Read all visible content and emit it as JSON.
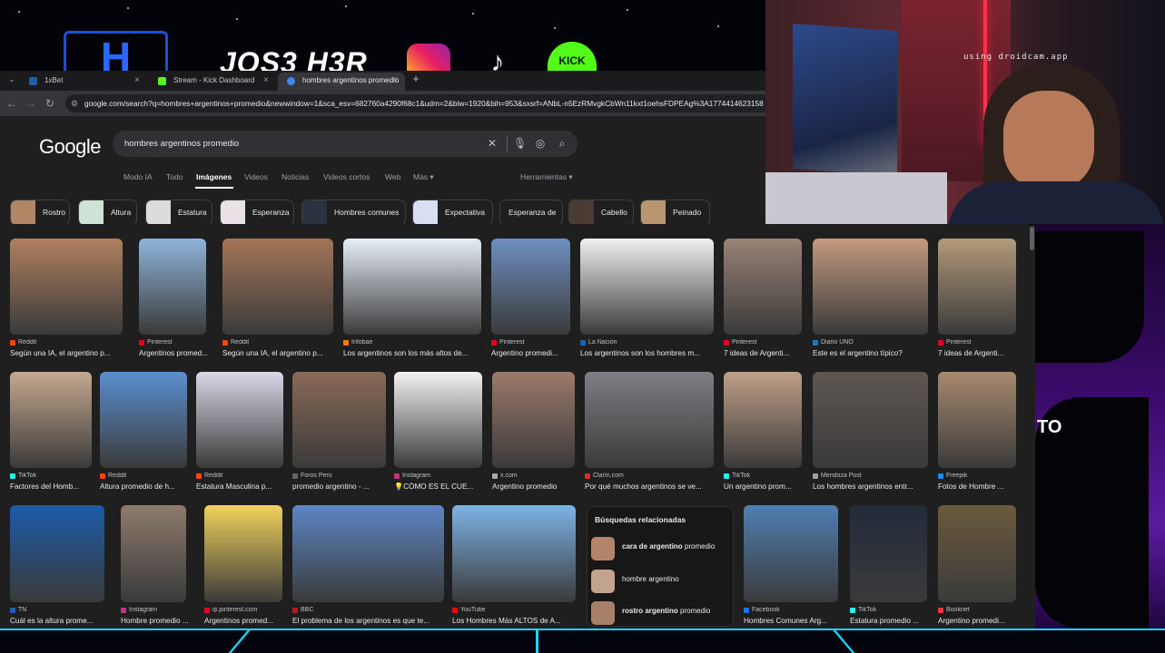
{
  "stream": {
    "logo_letter": "H",
    "streamer_name": "JOS3 H3R",
    "tiktok_glyph": "♪",
    "kick_label": "KICK",
    "webcam_watermark": "using droidcam.app",
    "overlay_text": "TO"
  },
  "browser": {
    "tabs": [
      {
        "label": "1xBet",
        "favicon_color": "#1e5fa8"
      },
      {
        "label": "Stream - Kick Dashboard",
        "favicon_color": "#53fc18"
      },
      {
        "label": "hombres argentinos promedio",
        "favicon_color": "#4285f4"
      }
    ],
    "url": "google.com/search?q=hombres+argentinos+promedio&newwindow=1&sca_esv=682760a4290f68c1&udm=2&biw=1920&bih=953&sxsrf=ANbL-n5EzRMvgkCbWn11kxt1oehsFDPEAg%3A1774414623158"
  },
  "search": {
    "logo": "Google",
    "query": "hombres argentinos promedio",
    "tabs": [
      "Modo IA",
      "Todo",
      "Imágenes",
      "Videos",
      "Noticias",
      "Videos cortos",
      "Web",
      "Más ▾"
    ],
    "active_tab": "Imágenes",
    "tools": "Herramientas ▾",
    "chips": [
      "Rostro",
      "Altura",
      "Estatura",
      "Esperanza",
      "Hombres comunes",
      "Expectativa",
      "Esperanza de",
      "Cabello",
      "Peinado"
    ]
  },
  "results": [
    {
      "source": "Reddit",
      "title": "Según una IA, el argentino p...",
      "color": "#b0805f",
      "icon": "#ff4500"
    },
    {
      "source": "Pinterest",
      "title": "Argentinos promed...",
      "color": "#8fb4d9",
      "icon": "#e60023"
    },
    {
      "source": "Reddit",
      "title": "Según una IA, el argentino p...",
      "color": "#a57658",
      "icon": "#ff4500"
    },
    {
      "source": "Infobae",
      "title": "Los argentinos son los más altos de...",
      "color": "#e7eef7",
      "icon": "#f57c00"
    },
    {
      "source": "Pinterest",
      "title": "Argentino promedi...",
      "color": "#6e8fc0",
      "icon": "#e60023"
    },
    {
      "source": "La Nación",
      "title": "Los argentinos son los hombres m...",
      "color": "#f1f1f1",
      "icon": "#1565c0"
    },
    {
      "source": "Pinterest",
      "title": "7 ideas de Argenti...",
      "color": "#9a8276",
      "icon": "#e60023"
    },
    {
      "source": "Diario UNO",
      "title": "Este es el argentino típico?",
      "color": "#c39a80",
      "icon": "#1976d2"
    },
    {
      "source": "Pinterest",
      "title": "7 ideas de Argenti...",
      "color": "#b39a7a",
      "icon": "#e60023"
    },
    {
      "source": "TikTok",
      "title": "Factores del Homb...",
      "color": "#c6a890",
      "icon": "#25f4ee"
    },
    {
      "source": "Reddit",
      "title": "Altura promedio de h...",
      "color": "#5a8fd0",
      "icon": "#ff4500"
    },
    {
      "source": "Reddit",
      "title": "Estatura Masculina p...",
      "color": "#d9d9e8",
      "icon": "#ff4500"
    },
    {
      "source": "Foros Perú",
      "title": "promedio argentino - ...",
      "color": "#8a6a58",
      "icon": "#666666"
    },
    {
      "source": "Instagram",
      "title": "💡CÓMO ES EL CUE...",
      "color": "#f3f3f3",
      "icon": "#c13584"
    },
    {
      "source": "x.com",
      "title": "Argentino promedio",
      "color": "#9c7a6a",
      "icon": "#aaaaaa"
    },
    {
      "source": "Clarín.com",
      "title": "Por qué muchos argentinos se ve...",
      "color": "#7e7f85",
      "icon": "#d32f2f"
    },
    {
      "source": "TikTok",
      "title": "Un argentino prom...",
      "color": "#c0a089",
      "icon": "#25f4ee"
    },
    {
      "source": "Mendoza Post",
      "title": "Los hombres argentinos entr...",
      "color": "#5e5751",
      "icon": "#9e9e9e"
    },
    {
      "source": "Freepik",
      "title": "Fotos de Hombre ...",
      "color": "#a88a6e",
      "icon": "#1e88e5"
    },
    {
      "source": "TN",
      "title": "Cuál es la altura prome...",
      "color": "#1c5aa8",
      "icon": "#1565c0"
    },
    {
      "source": "Instagram",
      "title": "Hombre promedio ...",
      "color": "#8e7b6c",
      "icon": "#c13584"
    },
    {
      "source": "ip.pinterest.com",
      "title": "Argentinos promed...",
      "color": "#f2d25a",
      "icon": "#e60023"
    },
    {
      "source": "BBC",
      "title": "El problema de los argentinos es que te...",
      "color": "#5c86c4",
      "icon": "#bb1919"
    },
    {
      "source": "YouTube",
      "title": "Los Hombres Más ALTOS de A...",
      "color": "#7db3e6",
      "icon": "#ff0000"
    },
    {
      "source": "Facebook",
      "title": "Hombres Comunes Arg...",
      "color": "#4f7fb2",
      "icon": "#1877f2"
    },
    {
      "source": "TikTok",
      "title": "Estatura promedio ...",
      "color": "#222b3a",
      "icon": "#25f4ee"
    },
    {
      "source": "Booknet",
      "title": "Argentino promedi...",
      "color": "#6b5a3c",
      "icon": "#e53935"
    }
  ],
  "related": {
    "heading": "Búsquedas relacionadas",
    "items": [
      {
        "bold": "cara de argentino",
        "rest": " promedio"
      },
      {
        "bold": "",
        "rest": "hombre argentino"
      },
      {
        "bold": "rostro argentino",
        "rest": " promedio"
      }
    ]
  }
}
